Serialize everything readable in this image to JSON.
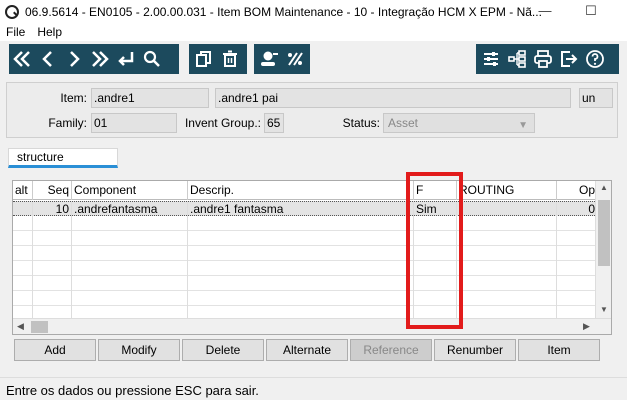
{
  "window": {
    "title": "06.9.5614 - EN0105 - 2.00.00.031 - Item BOM Maintenance - 10 - Integração HCM X EPM - Nã...",
    "minimize": "—",
    "maximize": "☐"
  },
  "menu": [
    "File",
    "Help"
  ],
  "toolbar": {
    "nav_icons": [
      "first-icon",
      "previous-icon",
      "next-icon",
      "last-icon",
      "goto-icon",
      "search-icon"
    ],
    "edit_icons": [
      "copy-icon",
      "delete-icon"
    ],
    "tool_icons": [
      "user-settings-icon",
      "formula-icon"
    ],
    "right_icons": [
      "sliders-icon",
      "hierarchy-icon",
      "print-icon",
      "exit-icon",
      "help-icon"
    ],
    "color": "#1c4a5d"
  },
  "form": {
    "item_label": "Item:",
    "item_value": ".andre1",
    "item_desc": ".andre1 pai",
    "unit": "un",
    "family_label": "Family:",
    "family_value": "01",
    "invent_group_label": "Invent Group.:",
    "invent_group_value": "65",
    "status_label": "Status:",
    "status_value": "Asset"
  },
  "tab": {
    "label": "structure",
    "accent": "#2a8fd6"
  },
  "grid": {
    "columns": [
      "alt",
      "Seq",
      "Component",
      "Descrip.",
      "F",
      "ROUTING",
      "Op"
    ],
    "rows": [
      {
        "alt": "",
        "seq": "10",
        "component": ".andrefantasma",
        "descrip": ".andre1 fantasma",
        "f": "Sim",
        "routing": "",
        "op": "0"
      }
    ]
  },
  "highlight": {
    "color": "#e21b1b"
  },
  "actions": [
    "Add",
    "Modify",
    "Delete",
    "Alternate",
    "Reference",
    "Renumber",
    "Item"
  ],
  "actions_disabled": [
    "Reference"
  ],
  "status": "Entre os dados ou pressione ESC para sair."
}
